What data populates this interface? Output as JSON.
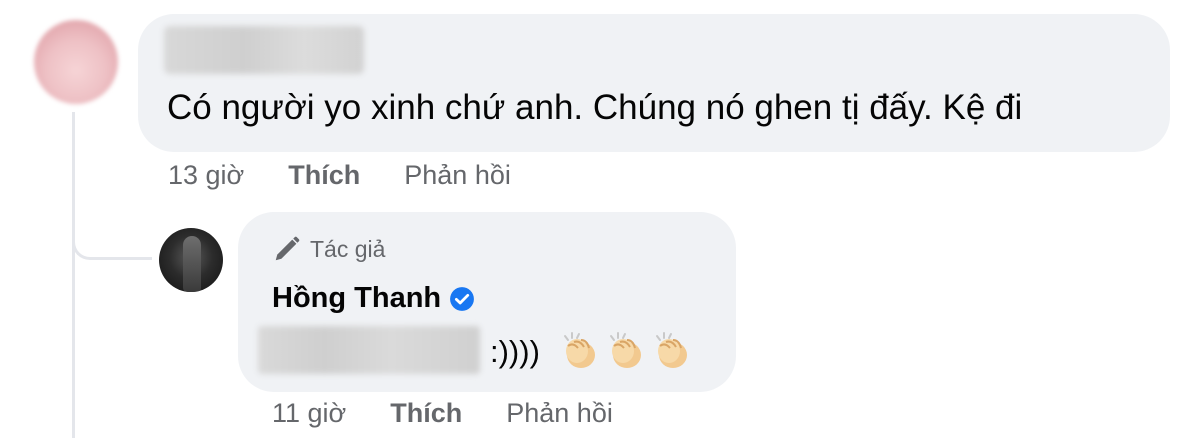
{
  "comment": {
    "author_name_redacted": true,
    "text": "Có người yo xinh chứ anh. Chúng nó ghen tị đấy. Kệ đi",
    "time": "13 giờ",
    "like_label": "Thích",
    "reply_label": "Phản hồi"
  },
  "reply": {
    "badge_label": "Tác giả",
    "author_name": "Hồng Thanh",
    "verified": true,
    "text": ":))))",
    "emojis": [
      "clapping-hands",
      "clapping-hands",
      "clapping-hands"
    ],
    "time": "11 giờ",
    "like_label": "Thích",
    "reply_label": "Phản hồi"
  },
  "colors": {
    "bubble": "#f0f2f5",
    "secondary_text": "#65676b",
    "verified_blue": "#1877f2",
    "thread_line": "#e4e6eb"
  }
}
